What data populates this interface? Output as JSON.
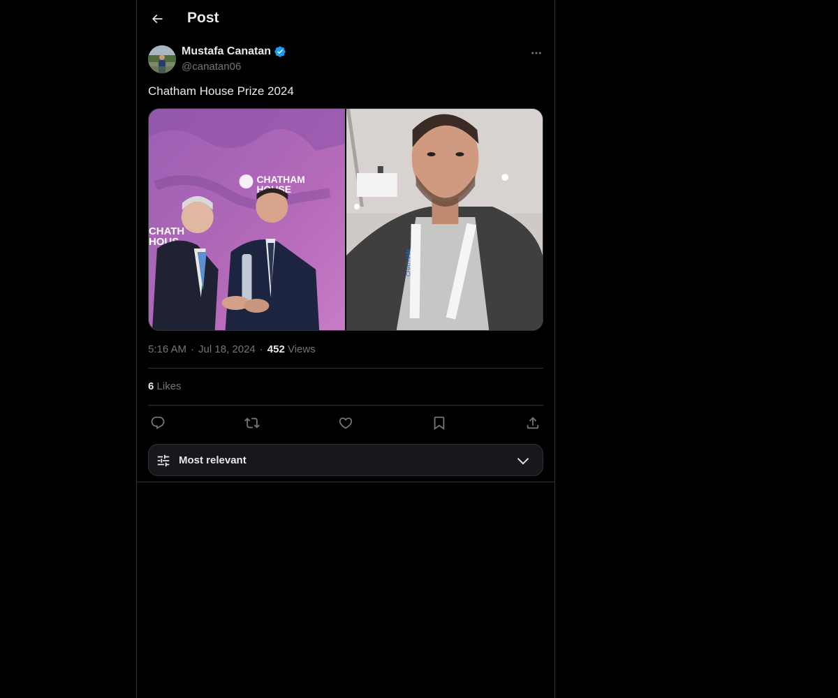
{
  "header": {
    "title": "Post",
    "back_icon": "arrow-left-icon"
  },
  "post": {
    "author": {
      "name": "Mustafa Canatan",
      "handle": "@canatan06",
      "verified": true,
      "verified_color": "#1d9bf0"
    },
    "text": "Chatham House Prize 2024",
    "media": {
      "count": 2,
      "image1_sign_text": "CHATHAM HOUSE",
      "image2_lanyard_text": "CHATHAM HOUSE"
    },
    "time": "5:16 AM",
    "separator": "·",
    "date": "Jul 18, 2024",
    "views_count": "452",
    "views_label": "Views",
    "likes_count": "6",
    "likes_label": "Likes"
  },
  "actions": [
    {
      "name": "reply",
      "icon": "reply-icon"
    },
    {
      "name": "repost",
      "icon": "repost-icon"
    },
    {
      "name": "like",
      "icon": "heart-icon"
    },
    {
      "name": "bookmark",
      "icon": "bookmark-icon"
    },
    {
      "name": "share",
      "icon": "share-icon"
    }
  ],
  "replies_sort": {
    "label": "Most relevant",
    "icon": "filter-sliders-icon",
    "chevron": "chevron-down-icon"
  },
  "colors": {
    "background": "#000000",
    "text_primary": "#e7e9ea",
    "text_secondary": "#71767b",
    "border": "#2f3336",
    "accent": "#1d9bf0"
  }
}
